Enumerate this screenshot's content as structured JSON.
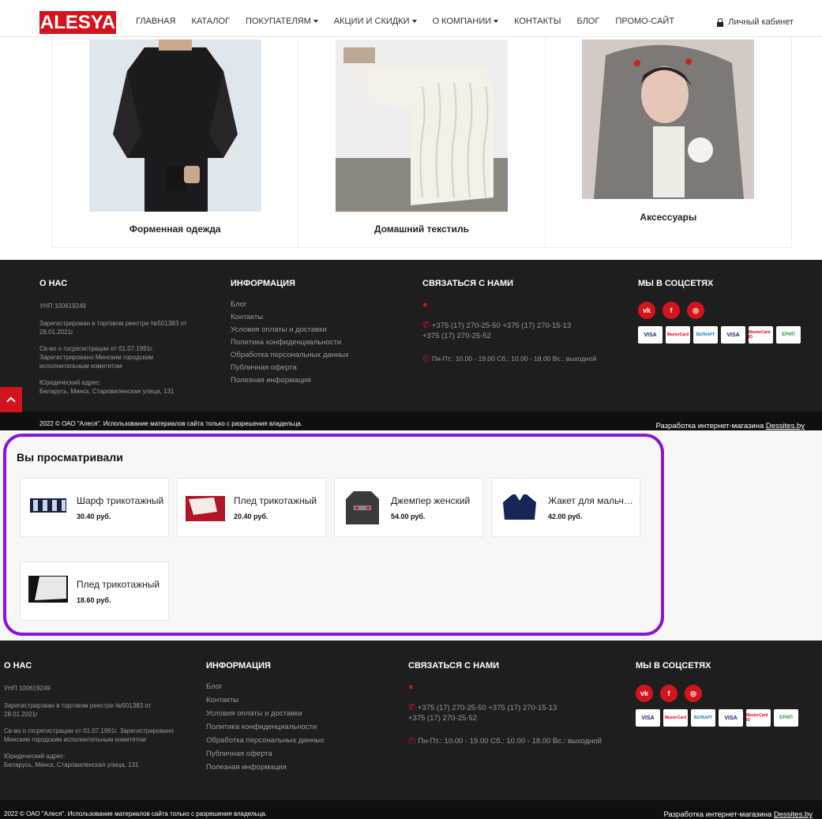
{
  "header": {
    "logo": "ALESYA",
    "nav": [
      {
        "label": "ГЛАВНАЯ",
        "dropdown": false
      },
      {
        "label": "КАТАЛОГ",
        "dropdown": false
      },
      {
        "label": "ПОКУПАТЕЛЯМ",
        "dropdown": true
      },
      {
        "label": "АКЦИИ И СКИДКИ",
        "dropdown": true
      },
      {
        "label": "О КОМПАНИИ",
        "dropdown": true
      },
      {
        "label": "КОНТАКТЫ",
        "dropdown": false
      },
      {
        "label": "БЛОГ",
        "dropdown": false
      },
      {
        "label": "ПРОМО-САЙТ",
        "dropdown": false
      }
    ],
    "account": "Личный кабинет"
  },
  "categories": [
    {
      "label": "Форменная одежда"
    },
    {
      "label": "Домашний текстиль"
    },
    {
      "label": "Аксессуары"
    }
  ],
  "footer": {
    "about": {
      "heading": "О НАС",
      "unp": "УНП 100619249",
      "reg": "Зарегистрирован в торговом реестре №501383 от 28.01.2021г",
      "cert": "Св-во о госрегистрации от 01.07.1991г. Зарегистрировано Минским городским исполнительным комитетом",
      "address_label": "Юридический адрес:",
      "address": "Беларусь, Минск, Старовиленская улица, 131"
    },
    "info": {
      "heading": "ИНФОРМАЦИЯ",
      "links": [
        "Блог",
        "Контакты",
        "Условия оплаты и доставки",
        "Политика конфиденциальности",
        "Обработка персональных данных",
        "Публичная оферта",
        "Полезная информация"
      ]
    },
    "contact": {
      "heading": "СВЯЗАТЬСЯ С НАМИ",
      "phones_line1": "+375 (17) 270-25-50  +375 (17) 270-15-13",
      "phones_line2": "+375 (17) 270-25-52",
      "hours": "Пн-Пт.: 10.00 - 19.00 Сб.: 10.00 - 18.00 Вс.: выходной"
    },
    "social": {
      "heading": "МЫ В СОЦСЕТЯХ",
      "networks": [
        "vk-icon",
        "facebook-icon",
        "instagram-icon"
      ],
      "payments": [
        "VISA",
        "MasterCard",
        "БЕЛКАРТ",
        "VISA",
        "MasterCard ID",
        "ЕРИП"
      ]
    },
    "copyright": "2022 © ОАО \"Алеся\". Использование материалов сайта только с разрешения владельца.",
    "dev_text": "Разработка интернет-магазина ",
    "dev_link": "Dessites.by"
  },
  "viewed": {
    "title": "Вы просматривали",
    "products": [
      {
        "name": "Шарф трикотажный",
        "price": "30.40 руб."
      },
      {
        "name": "Плед трикотажный",
        "price": "20.40 руб."
      },
      {
        "name": "Джемпер женский",
        "price": "54.00 руб."
      },
      {
        "name": "Жакет для мальчика",
        "price": "42.00 руб."
      },
      {
        "name": "Плед трикотажный",
        "price": "18.60 руб."
      }
    ]
  },
  "colors": {
    "brand_red": "#d4141c",
    "highlight_purple": "#8a17d6",
    "footer_bg": "#1e1e1e"
  }
}
